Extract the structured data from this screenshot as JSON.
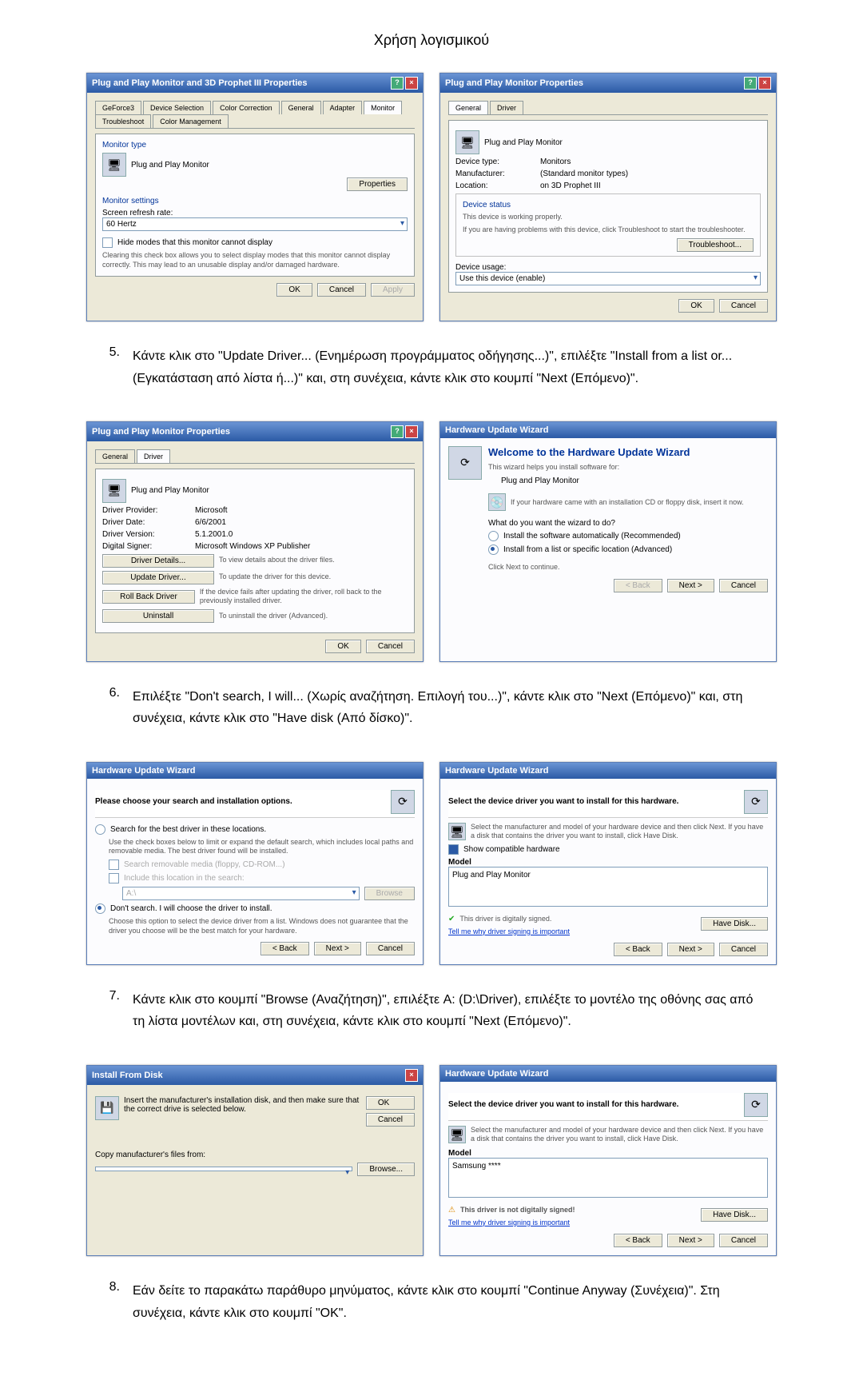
{
  "page_title": "Χρήση λογισμικού",
  "win1": {
    "title": "Plug and Play Monitor and 3D Prophet III Properties",
    "tabs": [
      "GeForce3",
      "Device Selection",
      "Color Correction",
      "General",
      "Adapter",
      "Monitor",
      "Troubleshoot",
      "Color Management"
    ],
    "active_tab": "Monitor",
    "group1": "Monitor type",
    "monitor_name": "Plug and Play Monitor",
    "props_btn": "Properties",
    "group2": "Monitor settings",
    "refresh_label": "Screen refresh rate:",
    "refresh_value": "60 Hertz",
    "hide_check": "Hide modes that this monitor cannot display",
    "hide_note": "Clearing this check box allows you to select display modes that this monitor cannot display correctly. This may lead to an unusable display and/or damaged hardware.",
    "ok": "OK",
    "cancel": "Cancel",
    "apply": "Apply"
  },
  "win2": {
    "title": "Plug and Play Monitor Properties",
    "tabs": [
      "General",
      "Driver"
    ],
    "active_tab": "General",
    "name": "Plug and Play Monitor",
    "dt_label": "Device type:",
    "dt_value": "Monitors",
    "mf_label": "Manufacturer:",
    "mf_value": "(Standard monitor types)",
    "loc_label": "Location:",
    "loc_value": "on 3D Prophet III",
    "status_group": "Device status",
    "status_text": "This device is working properly.",
    "status_help": "If you are having problems with this device, click Troubleshoot to start the troubleshooter.",
    "troubleshoot": "Troubleshoot...",
    "usage_label": "Device usage:",
    "usage_value": "Use this device (enable)",
    "ok": "OK",
    "cancel": "Cancel"
  },
  "step5": {
    "num": "5.",
    "text": "Κάντε κλικ στο \"Update Driver... (Ενημέρωση προγράμματος οδήγησης...)\", επιλέξτε \"Install from a list or...(Εγκατάσταση από λίστα ή...)\" και, στη συνέχεια, κάντε κλικ στο κουμπί \"Next (Επόμενο)\"."
  },
  "win3": {
    "title": "Plug and Play Monitor Properties",
    "tabs": [
      "General",
      "Driver"
    ],
    "active_tab": "Driver",
    "name": "Plug and Play Monitor",
    "dp_label": "Driver Provider:",
    "dp_value": "Microsoft",
    "dd_label": "Driver Date:",
    "dd_value": "6/6/2001",
    "dv_label": "Driver Version:",
    "dv_value": "5.1.2001.0",
    "ds_label": "Digital Signer:",
    "ds_value": "Microsoft Windows XP Publisher",
    "b1": "Driver Details...",
    "d1": "To view details about the driver files.",
    "b2": "Update Driver...",
    "d2": "To update the driver for this device.",
    "b3": "Roll Back Driver",
    "d3": "If the device fails after updating the driver, roll back to the previously installed driver.",
    "b4": "Uninstall",
    "d4": "To uninstall the driver (Advanced).",
    "ok": "OK",
    "cancel": "Cancel"
  },
  "win4": {
    "title": "Hardware Update Wizard",
    "heading": "Welcome to the Hardware Update Wizard",
    "sub": "This wizard helps you install software for:",
    "device": "Plug and Play Monitor",
    "cd_note": "If your hardware came with an installation CD or floppy disk, insert it now.",
    "q": "What do you want the wizard to do?",
    "r1": "Install the software automatically (Recommended)",
    "r2": "Install from a list or specific location (Advanced)",
    "next_hint": "Click Next to continue.",
    "back": "< Back",
    "next": "Next >",
    "cancel": "Cancel"
  },
  "step6": {
    "num": "6.",
    "text": "Επιλέξτε \"Don't search, I will... (Χωρίς αναζήτηση. Επιλογή του...)\", κάντε κλικ στο \"Next (Επόμενο)\" και, στη συνέχεια, κάντε κλικ στο \"Have disk (Από δίσκο)\"."
  },
  "win5": {
    "title": "Hardware Update Wizard",
    "heading": "Please choose your search and installation options.",
    "r1": "Search for the best driver in these locations.",
    "r1_note": "Use the check boxes below to limit or expand the default search, which includes local paths and removable media. The best driver found will be installed.",
    "c1": "Search removable media (floppy, CD-ROM...)",
    "c2": "Include this location in the search:",
    "path": "A:\\",
    "browse": "Browse",
    "r2": "Don't search. I will choose the driver to install.",
    "r2_note": "Choose this option to select the device driver from a list. Windows does not guarantee that the driver you choose will be the best match for your hardware.",
    "back": "< Back",
    "next": "Next >",
    "cancel": "Cancel"
  },
  "win6": {
    "title": "Hardware Update Wizard",
    "heading": "Select the device driver you want to install for this hardware.",
    "note": "Select the manufacturer and model of your hardware device and then click Next. If you have a disk that contains the driver you want to install, click Have Disk.",
    "compat": "Show compatible hardware",
    "model_label": "Model",
    "model": "Plug and Play Monitor",
    "signed": "This driver is digitally signed.",
    "why": "Tell me why driver signing is important",
    "have_disk": "Have Disk...",
    "back": "< Back",
    "next": "Next >",
    "cancel": "Cancel"
  },
  "step7": {
    "num": "7.",
    "text": "Κάντε κλικ στο κουμπί \"Browse (Αναζήτηση)\", επιλέξτε A: (D:\\Driver), επιλέξτε το μοντέλο της οθόνης σας από τη λίστα μοντέλων και, στη συνέχεια, κάντε κλικ στο κουμπί \"Next (Επόμενο)\"."
  },
  "win7": {
    "title": "Install From Disk",
    "msg": "Insert the manufacturer's installation disk, and then make sure that the correct drive is selected below.",
    "ok": "OK",
    "cancel": "Cancel",
    "copy_label": "Copy manufacturer's files from:",
    "path": "",
    "browse": "Browse..."
  },
  "win8": {
    "title": "Hardware Update Wizard",
    "heading": "Select the device driver you want to install for this hardware.",
    "note": "Select the manufacturer and model of your hardware device and then click Next. If you have a disk that contains the driver you want to install, click Have Disk.",
    "model_label": "Model",
    "model": "Samsung ****",
    "unsigned": "This driver is not digitally signed!",
    "why": "Tell me why driver signing is important",
    "have_disk": "Have Disk...",
    "back": "< Back",
    "next": "Next >",
    "cancel": "Cancel"
  },
  "step8": {
    "num": "8.",
    "text": "Εάν δείτε το παρακάτω παράθυρο μηνύματος, κάντε κλικ στο κουμπί \"Continue Anyway (Συνέχεια)\". Στη συνέχεια, κάντε κλικ στο κουμπί \"OK\"."
  }
}
